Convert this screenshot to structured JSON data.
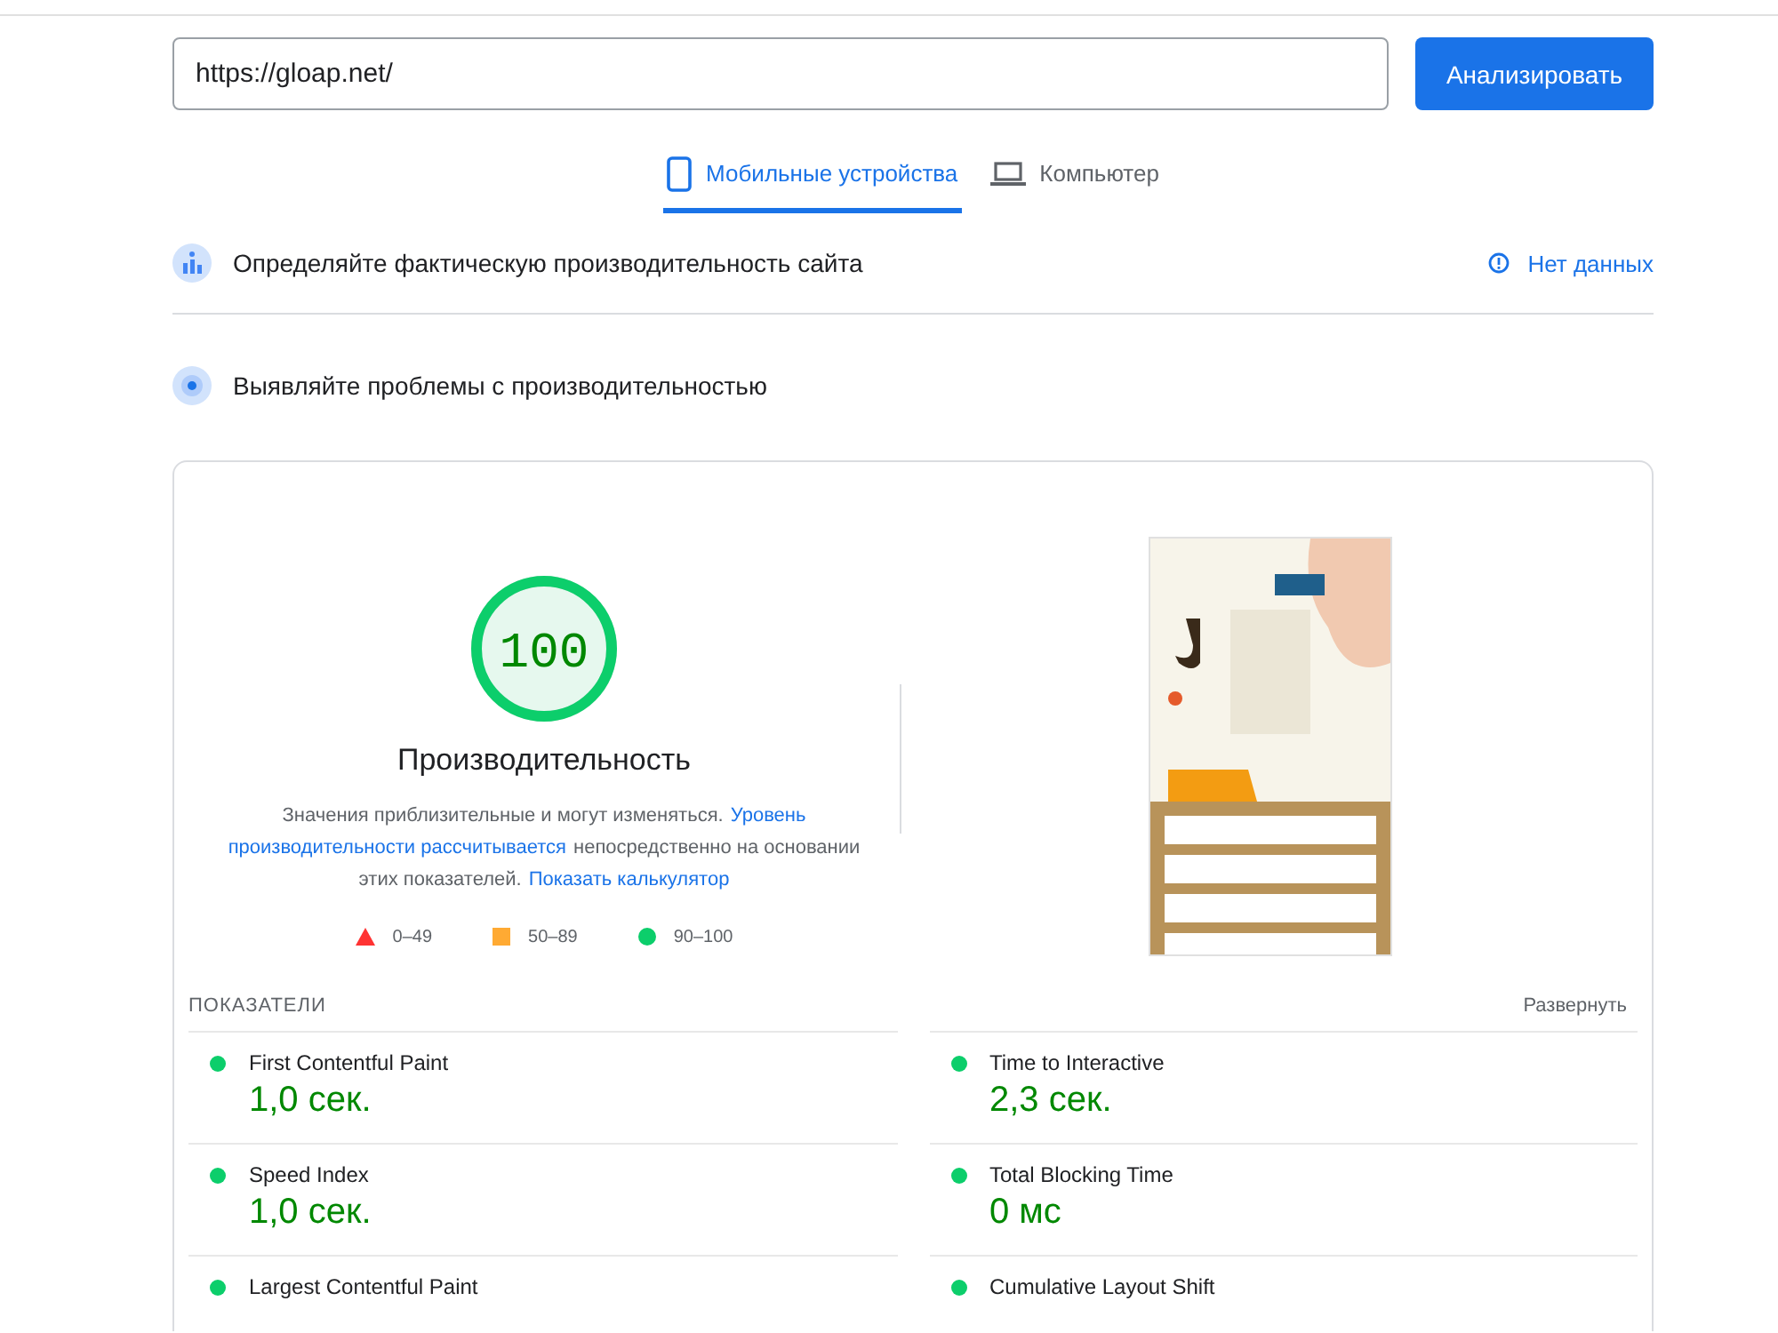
{
  "url_field": {
    "value": "https://gloap.net/"
  },
  "analyze_button": "Анализировать",
  "tabs": [
    {
      "label": "Мобильные устройства",
      "kind": "phone",
      "selected": true
    },
    {
      "label": "Компьютер",
      "kind": "laptop",
      "selected": false
    }
  ],
  "field_section": {
    "title": "Определяйте фактическую производительность сайта",
    "status": "Нет данных"
  },
  "lab_section": {
    "title": "Выявляйте проблемы с производительностью"
  },
  "score": {
    "value": "100",
    "level": 1,
    "color": "#0cce6b",
    "title": "Производительность",
    "description_lines": [
      [
        {
          "text": "Значения приблизительные и могут изменяться.",
          "link": false
        },
        {
          "text": "Уровень",
          "link": true
        }
      ],
      [
        {
          "text": "производительности рассчитывается",
          "link": true
        },
        {
          "text": "непосредственно на основании",
          "link": false
        }
      ],
      [
        {
          "text": "этих показателей.",
          "link": false
        },
        {
          "text": "Показать калькулятор",
          "link": true
        }
      ]
    ]
  },
  "legend": [
    {
      "kind": "triangle",
      "color": "#ff3333",
      "label": "0–49"
    },
    {
      "kind": "square",
      "color": "#ffaa33",
      "label": "50–89"
    },
    {
      "kind": "circle",
      "color": "#0cce6b",
      "label": "90–100"
    }
  ],
  "metrics_header": {
    "title": "ПОКАЗАТЕЛИ",
    "expand": "Развернуть"
  },
  "metrics": [
    {
      "name": "First Contentful Paint",
      "value": "1,0 сек.",
      "color": "#0cce6b"
    },
    {
      "name": "Time to Interactive",
      "value": "2,3 сек.",
      "color": "#0cce6b"
    },
    {
      "name": "Speed Index",
      "value": "1,0 сек.",
      "color": "#0cce6b"
    },
    {
      "name": "Total Blocking Time",
      "value": "0 мс",
      "color": "#0cce6b"
    },
    {
      "name": "Largest Contentful Paint",
      "color": "#0cce6b"
    },
    {
      "name": "Cumulative Layout Shift",
      "color": "#0cce6b"
    }
  ]
}
